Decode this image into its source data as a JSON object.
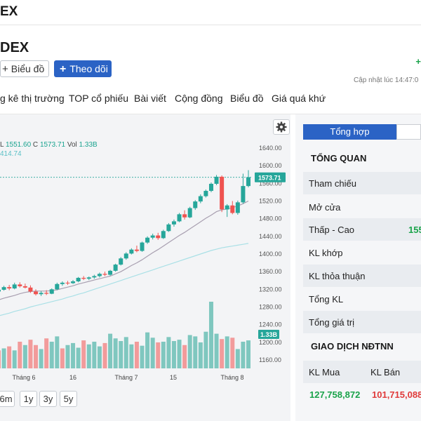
{
  "header": {
    "title": "EX"
  },
  "stock": {
    "name": "DEX",
    "change_fragment": "+"
  },
  "actions": {
    "chart_label": "Biểu đồ",
    "follow_label": "Theo dõi"
  },
  "updated_text": "Cập nhật lúc  14:47:0",
  "tabs": [
    "g kê thị trường",
    "TOP cổ phiếu",
    "Bài viết",
    "Cộng đồng",
    "Biểu đồ",
    "Giá quá khứ"
  ],
  "chart": {
    "ohlc_prefix": "L",
    "ohlc_low": "1551.60",
    "ohlc_close_label": "C",
    "ohlc_close": "1573.71",
    "ohlc_vol_label": "Vol",
    "ohlc_vol": "1.33B",
    "ma_value": "414.74",
    "price_tag": "1573.71",
    "volume_tag": "1.33B",
    "x_labels": [
      "Tháng 6",
      "16",
      "Tháng 7",
      "15",
      "Tháng 8"
    ],
    "periods": [
      "6m",
      "1y",
      "3y",
      "5y"
    ]
  },
  "chart_data": {
    "type": "candlestick",
    "title": "",
    "xlabel": "",
    "ylabel": "",
    "ylim": [
      1140,
      1660
    ],
    "y_ticks": [
      1160,
      1200,
      1240,
      1280,
      1320,
      1360,
      1400,
      1440,
      1480,
      1520,
      1560,
      1600,
      1640
    ],
    "candles": [
      [
        1315,
        1322,
        1312,
        1319
      ],
      [
        1319,
        1328,
        1317,
        1325
      ],
      [
        1325,
        1330,
        1318,
        1322
      ],
      [
        1322,
        1335,
        1320,
        1331
      ],
      [
        1331,
        1336,
        1324,
        1327
      ],
      [
        1327,
        1333,
        1322,
        1324
      ],
      [
        1324,
        1329,
        1312,
        1315
      ],
      [
        1315,
        1320,
        1306,
        1309
      ],
      [
        1309,
        1316,
        1305,
        1312
      ],
      [
        1312,
        1318,
        1307,
        1310
      ],
      [
        1310,
        1322,
        1309,
        1320
      ],
      [
        1320,
        1335,
        1318,
        1332
      ],
      [
        1332,
        1338,
        1328,
        1335
      ],
      [
        1335,
        1339,
        1330,
        1334
      ],
      [
        1334,
        1341,
        1332,
        1338
      ],
      [
        1338,
        1348,
        1336,
        1346
      ],
      [
        1346,
        1350,
        1341,
        1344
      ],
      [
        1344,
        1349,
        1341,
        1347
      ],
      [
        1347,
        1353,
        1344,
        1350
      ],
      [
        1350,
        1358,
        1347,
        1355
      ],
      [
        1355,
        1360,
        1350,
        1353
      ],
      [
        1353,
        1364,
        1351,
        1362
      ],
      [
        1362,
        1378,
        1360,
        1376
      ],
      [
        1376,
        1393,
        1374,
        1390
      ],
      [
        1390,
        1404,
        1387,
        1401
      ],
      [
        1401,
        1413,
        1399,
        1410
      ],
      [
        1410,
        1419,
        1404,
        1407
      ],
      [
        1407,
        1428,
        1405,
        1426
      ],
      [
        1426,
        1440,
        1423,
        1437
      ],
      [
        1437,
        1446,
        1433,
        1442
      ],
      [
        1442,
        1448,
        1432,
        1436
      ],
      [
        1436,
        1455,
        1434,
        1452
      ],
      [
        1452,
        1470,
        1450,
        1467
      ],
      [
        1467,
        1478,
        1462,
        1474
      ],
      [
        1474,
        1493,
        1472,
        1490
      ],
      [
        1490,
        1499,
        1478,
        1483
      ],
      [
        1483,
        1507,
        1481,
        1504
      ],
      [
        1504,
        1522,
        1500,
        1519
      ],
      [
        1519,
        1535,
        1515,
        1531
      ],
      [
        1531,
        1546,
        1528,
        1543
      ],
      [
        1543,
        1562,
        1540,
        1559
      ],
      [
        1559,
        1579,
        1556,
        1575
      ],
      [
        1575,
        1578,
        1495,
        1501
      ],
      [
        1501,
        1513,
        1484,
        1510
      ],
      [
        1510,
        1520,
        1490,
        1493
      ],
      [
        1493,
        1521,
        1489,
        1517
      ],
      [
        1517,
        1582,
        1514,
        1554
      ],
      [
        1554,
        1590,
        1551,
        1574
      ]
    ],
    "ma_fast": [
      1296,
      1300,
      1303,
      1306,
      1310,
      1313,
      1315,
      1316,
      1316,
      1316,
      1317,
      1319,
      1322,
      1325,
      1328,
      1332,
      1335,
      1338,
      1341,
      1344,
      1347,
      1350,
      1355,
      1360,
      1367,
      1374,
      1380,
      1387,
      1395,
      1403,
      1410,
      1418,
      1426,
      1434,
      1442,
      1449,
      1457,
      1465,
      1473,
      1481,
      1488,
      1496,
      1500,
      1502,
      1505,
      1509,
      1514,
      1520
    ],
    "ma_slow": [
      1260,
      1263,
      1266,
      1270,
      1273,
      1276,
      1280,
      1283,
      1286,
      1289,
      1292,
      1295,
      1298,
      1302,
      1305,
      1309,
      1312,
      1316,
      1320,
      1324,
      1328,
      1332,
      1336,
      1340,
      1344,
      1348,
      1352,
      1356,
      1360,
      1364,
      1368,
      1372,
      1376,
      1380,
      1384,
      1388,
      1392,
      1396,
      1400,
      1404,
      1408,
      1411,
      1414,
      1416,
      1418,
      1420,
      1422,
      1424
    ],
    "volume_fraction": [
      0.27,
      0.3,
      0.33,
      0.27,
      0.4,
      0.35,
      0.43,
      0.35,
      0.29,
      0.45,
      0.4,
      0.48,
      0.3,
      0.35,
      0.38,
      0.31,
      0.42,
      0.36,
      0.4,
      0.33,
      0.38,
      0.52,
      0.45,
      0.41,
      0.47,
      0.36,
      0.4,
      0.34,
      0.54,
      0.46,
      0.39,
      0.4,
      0.47,
      0.41,
      0.43,
      0.35,
      0.5,
      0.48,
      0.39,
      0.55,
      1.0,
      0.52,
      0.44,
      0.48,
      0.46,
      0.29,
      0.4,
      0.42
    ],
    "volume_up": [
      false,
      true,
      false,
      true,
      false,
      true,
      false,
      false,
      true,
      false,
      true,
      true,
      false,
      true,
      true,
      true,
      false,
      true,
      true,
      true,
      false,
      true,
      true,
      true,
      true,
      true,
      false,
      true,
      true,
      true,
      false,
      true,
      true,
      true,
      true,
      false,
      true,
      true,
      true,
      true,
      true,
      true,
      false,
      true,
      false,
      true,
      true,
      true
    ],
    "price_line": 1573.71,
    "grid": false
  },
  "overview": {
    "tab_active": "Tổng hợp",
    "title": "TỔNG QUAN",
    "rows": [
      {
        "label": "Tham chiếu",
        "value": ""
      },
      {
        "label": "Mở cửa",
        "value": ""
      },
      {
        "label": "Thấp - Cao",
        "value": "155"
      },
      {
        "label": "KL khớp",
        "value": ""
      },
      {
        "label": "KL thỏa thuận",
        "value": ""
      },
      {
        "label": "Tổng KL",
        "value": ""
      },
      {
        "label": "Tổng giá trị",
        "value": ""
      }
    ],
    "foreign_title": "GIAO DỊCH NĐTNN",
    "buy_label": "KL Mua",
    "sell_label": "KL Bán",
    "buy_value": "127,758,872",
    "sell_value": "101,715,088"
  }
}
